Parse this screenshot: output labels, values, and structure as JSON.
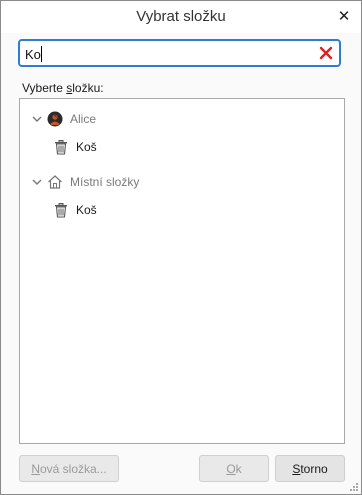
{
  "dialog": {
    "title": "Vybrat složku",
    "close_glyph": "✕"
  },
  "search": {
    "value": "Ko",
    "clear_icon": "red-x"
  },
  "list": {
    "label_prefix": "Vyberte ",
    "label_accel": "s",
    "label_suffix": "ložku:"
  },
  "tree": {
    "items": [
      {
        "label": "Alice",
        "type": "account",
        "icon": "avatar",
        "expanded": true
      },
      {
        "label": "Koš",
        "type": "folder",
        "icon": "trash-icon"
      },
      {
        "label": "Místní složky",
        "type": "account",
        "icon": "home-icon",
        "expanded": true
      },
      {
        "label": "Koš",
        "type": "folder",
        "icon": "trash-icon"
      }
    ]
  },
  "buttons": {
    "new_folder": {
      "accel": "N",
      "rest": "ová složka...",
      "enabled": false
    },
    "ok": {
      "accel": "O",
      "rest": "k",
      "enabled": false
    },
    "cancel": {
      "accel": "S",
      "rest": "torno",
      "enabled": true
    }
  },
  "colors": {
    "focus_border": "#2f7dd1",
    "clear_red": "#e02020"
  }
}
